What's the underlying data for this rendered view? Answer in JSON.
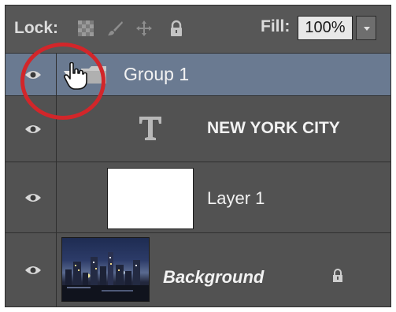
{
  "lockbar": {
    "lock_label": "Lock:",
    "fill_label": "Fill:",
    "fill_value": "100%",
    "icons": [
      "lock-transparent-pixels-icon",
      "lock-image-pixels-icon",
      "lock-position-icon",
      "lock-all-icon"
    ]
  },
  "layers": [
    {
      "name": "Group 1",
      "kind": "group",
      "selected": true,
      "visible": true
    },
    {
      "name": "NEW YORK CITY",
      "kind": "text",
      "visible": true
    },
    {
      "name": "Layer 1",
      "kind": "pixel",
      "visible": true
    },
    {
      "name": "Background",
      "kind": "background",
      "locked": true,
      "visible": true
    }
  ],
  "colors": {
    "panel_bg": "#525252",
    "selected_row": "#6a7a91",
    "highlight_circle": "#d2262a"
  }
}
